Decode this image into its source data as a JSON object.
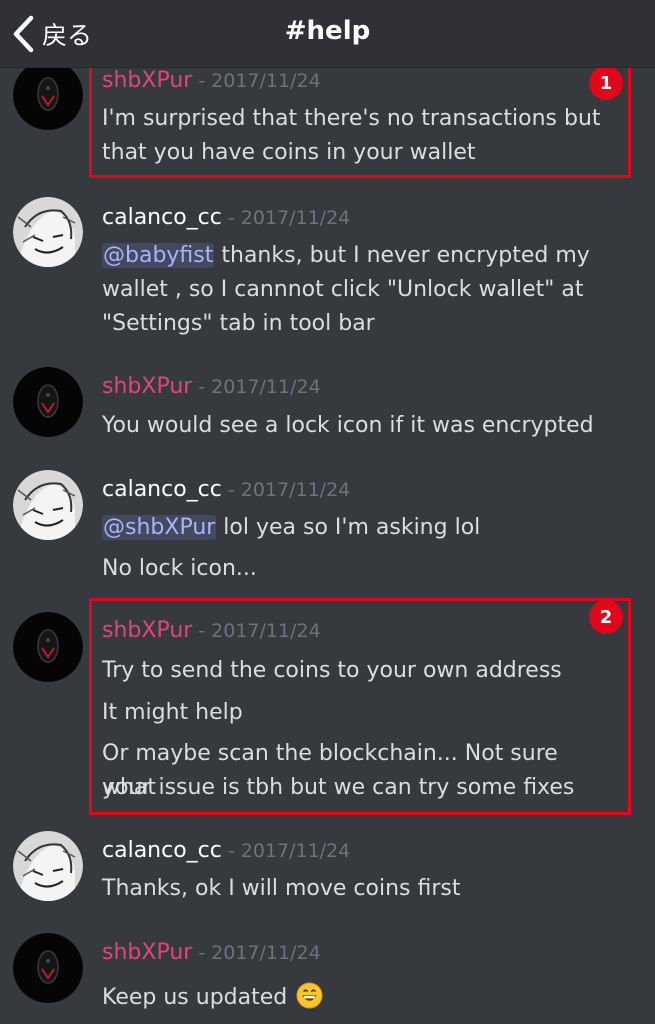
{
  "header": {
    "back_label": "戻る",
    "title": "#help"
  },
  "messages": [
    {
      "user": "shbXPur",
      "date": "2017/11/24",
      "lines": [
        "I'm surprised that there's no transactions but",
        "that you have coins in your wallet"
      ]
    },
    {
      "user": "calanco_cc",
      "date": "2017/11/24",
      "mention": "@babyfist",
      "lines": [
        " thanks, but I never encrypted my",
        "wallet , so I cannnot click \"Unlock wallet\" at",
        "\"Settings\" tab in tool bar"
      ]
    },
    {
      "user": "shbXPur",
      "date": "2017/11/24",
      "lines": [
        "You would see a lock icon if it was encrypted"
      ]
    },
    {
      "user": "calanco_cc",
      "date": "2017/11/24",
      "mention": "@shbXPur",
      "lines": [
        " lol yea so I'm asking lol",
        "No lock icon..."
      ]
    },
    {
      "user": "shbXPur",
      "date": "2017/11/24",
      "lines": [
        "Try to send the coins to your own address",
        "It might help",
        "Or maybe scan the blockchain... Not sure what",
        "your issue is tbh but we can try some fixes"
      ]
    },
    {
      "user": "calanco_cc",
      "date": "2017/11/24",
      "lines": [
        "Thanks, ok I will move coins first"
      ]
    },
    {
      "user": "shbXPur",
      "date": "2017/11/24",
      "lines": [
        "Keep us updated "
      ],
      "emoji": "grinning-face-emoji"
    }
  ],
  "annotations": [
    {
      "label": "1"
    },
    {
      "label": "2"
    }
  ],
  "icons": {
    "back": "chevron-left-icon",
    "emoji": "grinning-face-emoji"
  },
  "colors": {
    "header_bg": "#2f3136",
    "chat_bg": "#36393e",
    "username_pink": "#e0457b",
    "highlight_red": "#e0061b",
    "mention": "#a9b3f7"
  }
}
